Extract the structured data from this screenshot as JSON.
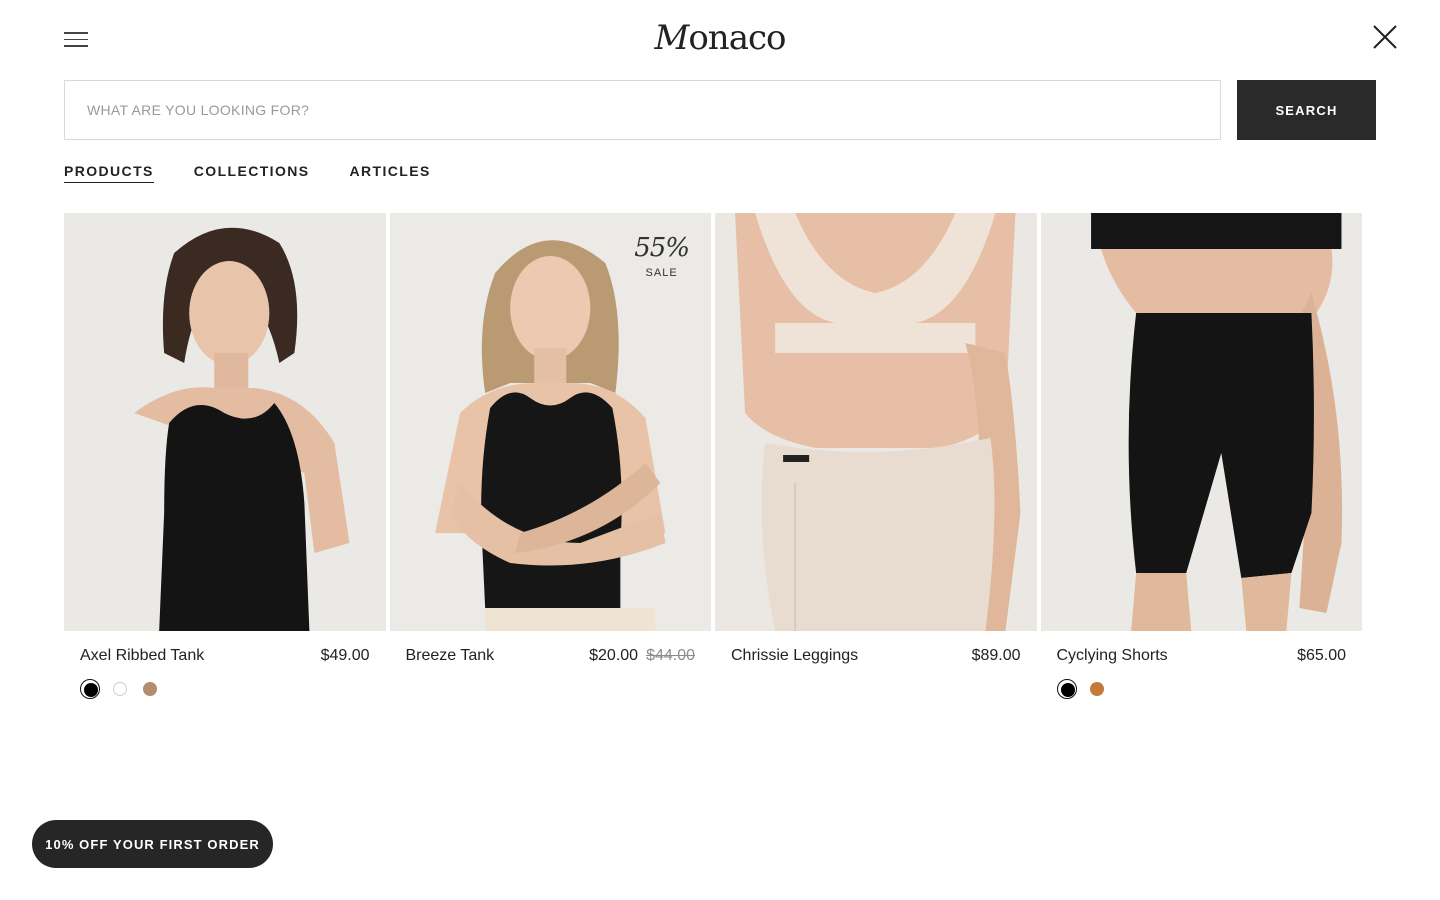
{
  "header": {
    "logo_text": "Monaco",
    "menu_icon": "hamburger-icon",
    "close_icon": "close-icon"
  },
  "search": {
    "placeholder": "WHAT ARE YOU LOOKING FOR?",
    "value": "",
    "button_label": "SEARCH"
  },
  "tabs": [
    {
      "label": "PRODUCTS",
      "active": true
    },
    {
      "label": "COLLECTIONS",
      "active": false
    },
    {
      "label": "ARTICLES",
      "active": false
    }
  ],
  "products": [
    {
      "name": "Axel Ribbed Tank",
      "price": "$49.00",
      "swatches": [
        {
          "color": "#000000",
          "selected": true
        },
        {
          "color": "#ffffff",
          "selected": false
        },
        {
          "color": "#b38b6d",
          "selected": false
        }
      ]
    },
    {
      "name": "Breeze Tank",
      "price": "$20.00",
      "compare_price": "$44.00",
      "badge": {
        "percent": "55%",
        "label": "SALE"
      }
    },
    {
      "name": "Chrissie Leggings",
      "price": "$89.00"
    },
    {
      "name": "Cyclying Shorts",
      "price": "$65.00",
      "swatches": [
        {
          "color": "#000000",
          "selected": true
        },
        {
          "color": "#c47a3a",
          "selected": false
        }
      ]
    }
  ],
  "promo": {
    "label": "10% OFF YOUR FIRST ORDER"
  },
  "colors": {
    "button_dark": "#2a2a2a",
    "image_background": "#ebe9e6",
    "text": "#222222",
    "muted": "#8c8c8c"
  }
}
